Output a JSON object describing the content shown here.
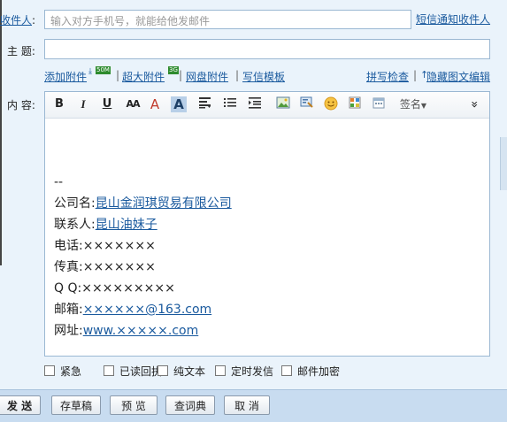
{
  "header": {
    "to_label": "收件人",
    "to_colon": ":",
    "to_placeholder": "输入对方手机号，就能给他发邮件",
    "sms_notify": "短信通知收件人",
    "subject_label": "主  题:",
    "subject_value": ""
  },
  "attachments": {
    "add": "添加附件",
    "add_badge": "50M",
    "big": "超大附件",
    "big_badge": "3G",
    "disk": "网盘附件",
    "template": "写信模板",
    "spellcheck": "拼写检查",
    "hide_richtext": "隐藏图文编辑"
  },
  "editor": {
    "content_label": "内  容:",
    "toolbar": {
      "bold": "B",
      "italic": "I",
      "underline": "U",
      "font_size": "AA",
      "font_color": "A",
      "bg_color": "A",
      "signature": "签名",
      "more": "»"
    },
    "body": {
      "divider": "--",
      "company_label": "公司名:",
      "company_value": "昆山金润琪贸易有限公司",
      "contact_label": "联系人:",
      "contact_value": "昆山油妹子",
      "phone_label": "电话:",
      "phone_value": "×××××××",
      "fax_label": "传真:",
      "fax_value": "×××××××",
      "qq_label": "Q Q:",
      "qq_value": "×××××××××",
      "email_label": "邮箱:",
      "email_value": "××××××@163.com",
      "site_label": "网址:",
      "site_value": "www.×××××.com"
    }
  },
  "options": [
    "紧急",
    "已读回执",
    "纯文本",
    "定时发信",
    "邮件加密"
  ],
  "buttons": {
    "send": "发 送",
    "draft": "存草稿",
    "preview": "预 览",
    "dictionary": "查词典",
    "cancel": "取 消"
  },
  "colors": {
    "link": "#1a5a9e",
    "border": "#9bb8d3",
    "bar": "#c8dcf0"
  }
}
